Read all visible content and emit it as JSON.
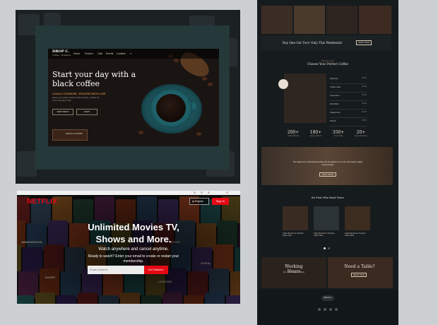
{
  "coffee_site": {
    "logo": "DROP C.",
    "tagline": "Coffee · Roasters",
    "nav": [
      "Home",
      "Product",
      "Cafe",
      "Events",
      "Location"
    ],
    "hero_title": "Start your day with a black coffee",
    "sub_heading": "LOCALLY SOURCED • ROASTED WITH LOVE",
    "description": "Enjoy our locally roasted coffee blends, crafted for your everyday ritual.",
    "primary_button": "VIEW MENU",
    "secondary_button": "SHOP",
    "thumb_label": "WATCH A STORY"
  },
  "netflix": {
    "logo": "NETFLIX",
    "language": "English",
    "signin_label": "Sign In",
    "headline": "Unlimited Movies TV, Shows and More.",
    "subline": "Watch anywhere and cancel anytime.",
    "cta": "Ready to watch? Enter your email to create or restart your membership.",
    "email_placeholder": "Email address",
    "get_started": "Get Started",
    "posters": [
      "ARMAGEDDON",
      "STRANGER",
      "MOKER",
      "SPIRAL",
      "LEGENDS",
      "BADER"
    ]
  },
  "long_page": {
    "promo": "Buy One Get Two! Only This Weekends!",
    "promo_button": "SHOP NOW",
    "section_kicker": "Choose Your",
    "section_title": "Choose Your Perfect Coffee",
    "menu_items": [
      {
        "name": "Espresso",
        "price": "$3.50"
      },
      {
        "name": "Coffee Latte",
        "price": "$4.00"
      },
      {
        "name": "Americano",
        "price": "$3.00"
      },
      {
        "name": "Flat White",
        "price": "$4.50"
      },
      {
        "name": "Cappuccino",
        "price": "$4.00"
      },
      {
        "name": "Mocha",
        "price": "$5.00"
      }
    ],
    "stats": [
      {
        "num": "200+",
        "label": "Coffee Blends"
      },
      {
        "num": "180+",
        "label": "Happy Clients"
      },
      {
        "num": "350+",
        "label": "Cups Daily"
      },
      {
        "num": "20+",
        "label": "Expert Baristas"
      }
    ],
    "quote": "The coffee here is absolutely amazing, the atmosphere is so cozy and relaxing. Highly recommended.",
    "quote_button": "READ MORE",
    "news_title": "Be First Who Read News",
    "news": [
      {
        "title": "Coffee Blends For The Best Coffee Taste"
      },
      {
        "title": "Coffee Blends For The Best Coffee Taste"
      },
      {
        "title": "Coffee Blends For The Best Coffee Taste"
      }
    ],
    "hours_title": "Working Hours",
    "hours_text": "Mon - Fri: 8:00am - 10:00pm",
    "table_title": "Need a Table?",
    "table_button": "BOOK NOW",
    "footer_logo": "DROP C."
  },
  "colors": {
    "page_bg": "#cdd0d3",
    "netflix_red": "#e50914",
    "coffee_accent": "#d4893a",
    "cup_teal": "#1f6069"
  }
}
